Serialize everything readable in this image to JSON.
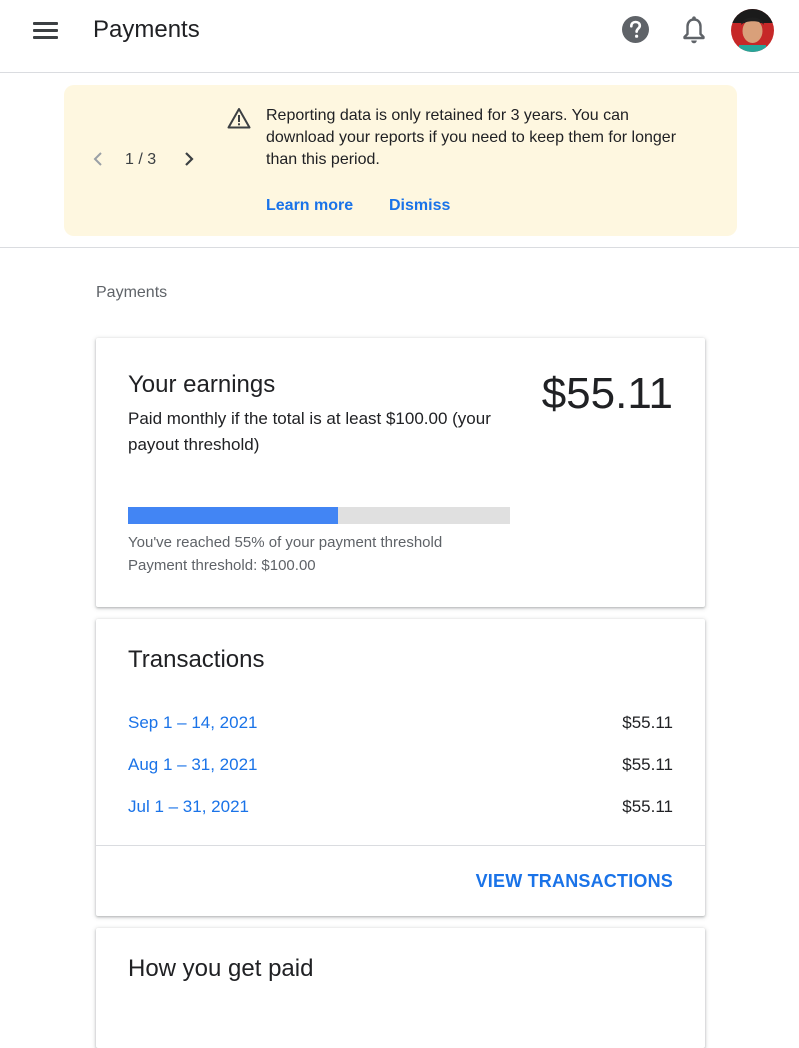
{
  "header": {
    "title": "Payments"
  },
  "banner": {
    "pager": "1 / 3",
    "message": "Reporting data is only retained for 3 years. You can download your reports if you need to keep them for longer than this period.",
    "learn_more": "Learn more",
    "dismiss": "Dismiss"
  },
  "breadcrumb": "Payments",
  "earnings": {
    "title": "Your earnings",
    "amount": "$55.11",
    "description": "Paid monthly if the total is at least $100.00 (your payout threshold)",
    "progress_fraction": 0.55,
    "progress_note": "You've reached 55% of your payment threshold",
    "threshold_note": "Payment threshold: $100.00"
  },
  "transactions": {
    "title": "Transactions",
    "rows": [
      {
        "date": "Sep 1 – 14, 2021",
        "amount": "$55.11"
      },
      {
        "date": "Aug 1 – 31, 2021",
        "amount": "$55.11"
      },
      {
        "date": "Jul 1 – 31, 2021",
        "amount": "$55.11"
      }
    ],
    "view_all": "VIEW TRANSACTIONS"
  },
  "how_paid": {
    "title": "How you get paid"
  },
  "colors": {
    "accent": "#1a73e8",
    "progress": "#4285f4",
    "banner_bg": "#fef7e0"
  },
  "icons": {
    "menu": "menu-icon",
    "help": "help-icon",
    "notifications": "bell-icon",
    "warning": "warning-icon",
    "prev": "chevron-left-icon",
    "next": "chevron-right-icon"
  }
}
